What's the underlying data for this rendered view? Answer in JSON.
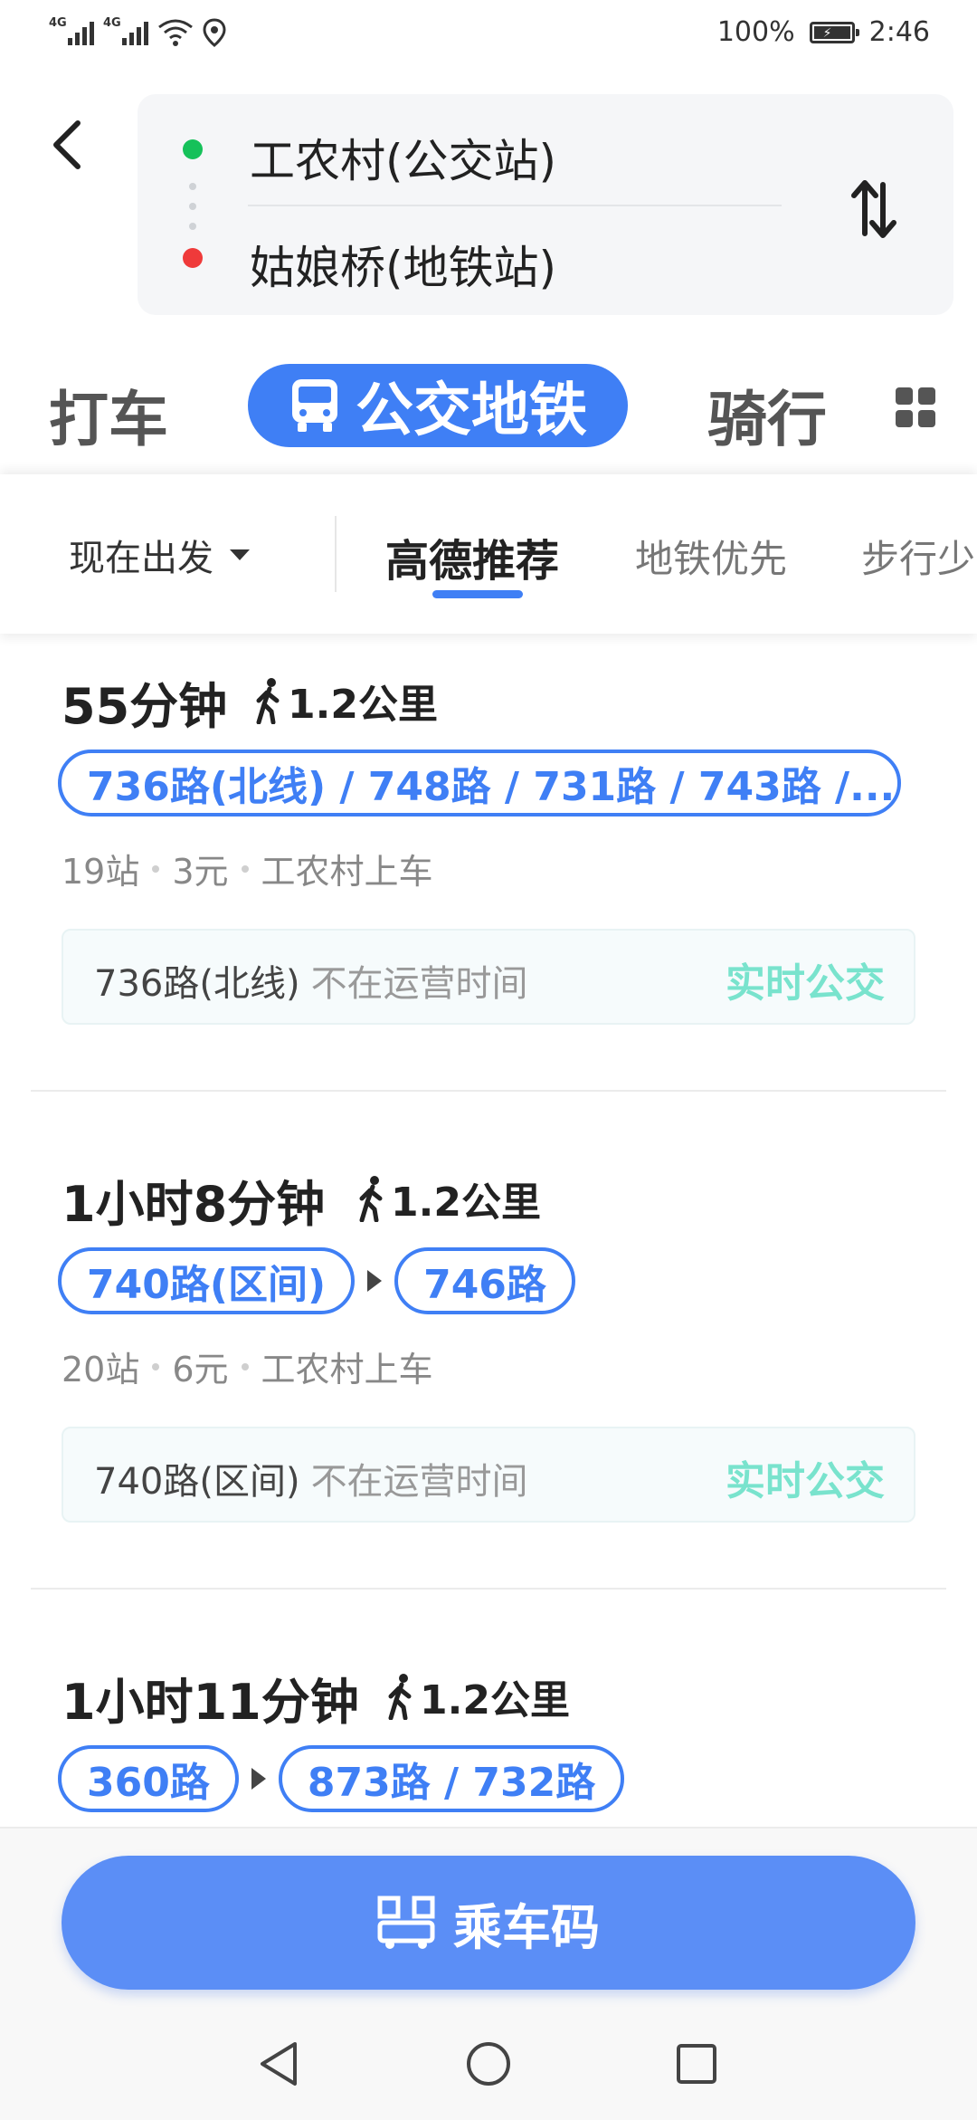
{
  "status_bar": {
    "signal1": "4G",
    "signal2": "4G",
    "battery_percent": "100%",
    "time": "2:46"
  },
  "route": {
    "from": "工农村(公交站)",
    "to": "姑娘桥(地铁站)"
  },
  "modes": {
    "taxi": "打车",
    "transit": "公交地铁",
    "bike": "骑行"
  },
  "filters": {
    "depart": "现在出发",
    "sort_recommended": "高德推荐",
    "sort_subway": "地铁优先",
    "sort_less_walk": "步行少"
  },
  "routes": [
    {
      "duration": "55分钟",
      "walk": "1.2公里",
      "lines": [
        "736路(北线) / 748路 / 731路 / 743路 /..."
      ],
      "stops": "19站",
      "price": "3元",
      "board": "工农村上车",
      "realtime_line": "736路(北线)",
      "realtime_status": "不在运营时间",
      "realtime_label": "实时公交"
    },
    {
      "duration": "1小时8分钟",
      "walk": "1.2公里",
      "lines": [
        "740路(区间)",
        "746路"
      ],
      "stops": "20站",
      "price": "6元",
      "board": "工农村上车",
      "realtime_line": "740路(区间)",
      "realtime_status": "不在运营时间",
      "realtime_label": "实时公交"
    },
    {
      "duration": "1小时11分钟",
      "walk": "1.2公里",
      "lines": [
        "360路",
        "873路 / 732路"
      ]
    }
  ],
  "bottom": {
    "ride_code": "乘车码"
  },
  "colors": {
    "accent": "#3f7ff5",
    "button": "#5b8ef6",
    "realtime": "#79e3cd",
    "start_dot": "#16c15a",
    "end_dot": "#ef3a3a"
  }
}
